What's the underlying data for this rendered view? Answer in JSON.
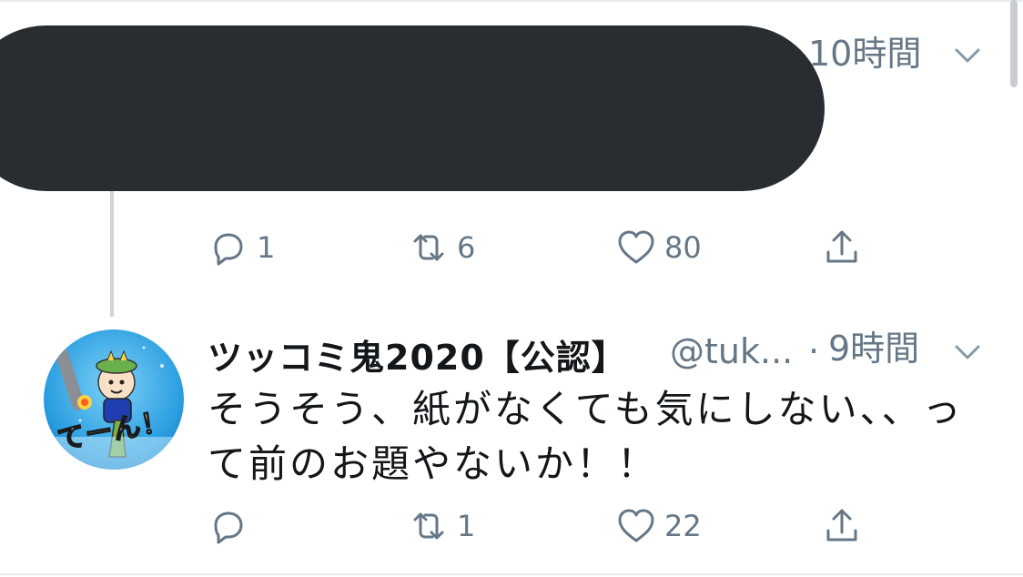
{
  "tweet1": {
    "time": "10時間",
    "reply_count": "1",
    "retweet_count": "6",
    "like_count": "80",
    "partial_text": "・・ ・・・ ・ ・ ・・ ・ ・・"
  },
  "tweet2": {
    "display_name": "ツッコミ鬼2020【公認】",
    "handle": "@tuk...",
    "separator": "·",
    "time": "9時間",
    "text": "そうそう、紙がなくても気にしない、、って前のお題やないか！！",
    "avatar_text": "てーん！",
    "reply_count": "",
    "retweet_count": "1",
    "like_count": "22"
  },
  "icons": {
    "reply": "reply-icon",
    "retweet": "retweet-icon",
    "like": "heart-icon",
    "share": "share-icon",
    "caret": "chevron-down-icon"
  },
  "colors": {
    "icon_gray": "#657786",
    "text": "#14171a",
    "thread_line": "#ccd6dd",
    "redaction": "#292d31"
  }
}
